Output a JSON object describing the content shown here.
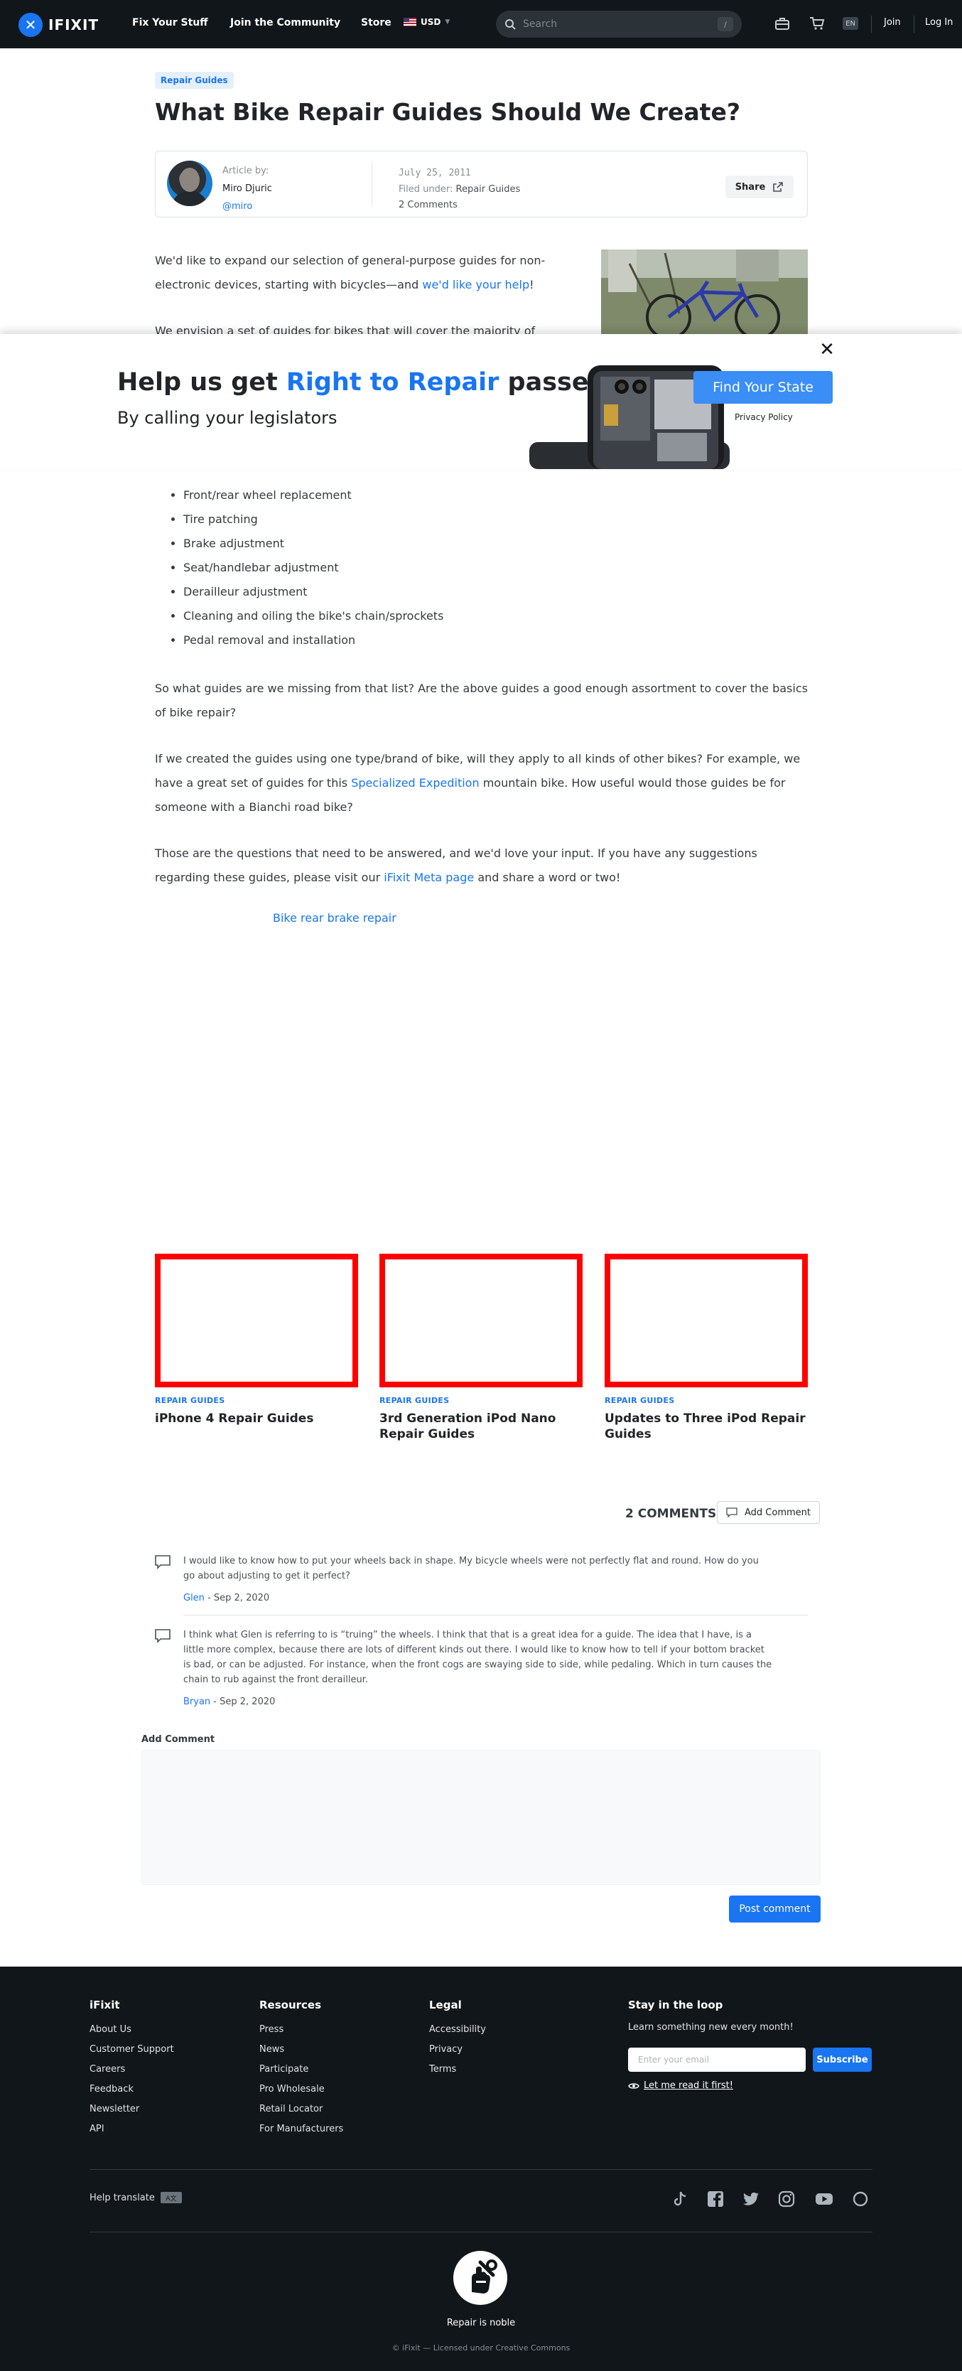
{
  "nav": {
    "logo_text": "IFIXIT",
    "links": [
      "Fix Your Stuff",
      "Join the Community",
      "Store"
    ],
    "currency": "USD",
    "search_placeholder": "Search",
    "search_shortcut": "/",
    "language": "EN",
    "join": "Join",
    "login": "Log In"
  },
  "article": {
    "tag": "Repair Guides",
    "title": "What Bike Repair Guides Should We Create?",
    "byline_label": "Article by:",
    "author": "Miro Djuric",
    "handle": "@miro",
    "date": "July 25, 2011",
    "filed_label": "Filed under:",
    "filed_value": "Repair Guides",
    "comments": "2 Comments",
    "share": "Share",
    "p1_text": "We'd like to expand our selection of general-purpose guides for non-electronic devices, starting with bicycles—and ",
    "p1_link": "we'd like your help",
    "p1_end": "!",
    "p2_partial": "We envision a set of guides for bikes that will cover the majority of",
    "list": [
      "Front/rear wheel replacement",
      "Tire patching",
      "Brake adjustment",
      "Seat/handlebar adjustment",
      "Derailleur adjustment",
      "Cleaning and oiling the bike's chain/sprockets",
      "Pedal removal and installation"
    ],
    "p3": "So what guides are we missing from that list? Are the above guides a good enough assortment to cover the basics of bike repair?",
    "p4_text": "If we created the guides using one type/brand of bike, will they apply to all kinds of other bikes? For example, we have a great set of guides for this ",
    "p4_link": "Specialized Expedition",
    "p4_end": " mountain bike. How useful would those guides be for someone with a Bianchi road bike?",
    "p5_text": "Those are the questions that need to be answered, and we'd love your input. If you have any suggestions regarding these guides, please visit our ",
    "p5_link": "iFixit Meta page",
    "p5_end": " and share a word or two!",
    "image_link": "Bike rear brake repair"
  },
  "banner": {
    "title_pre": "Help us get ",
    "title_highlight": "Right to Repair",
    "title_post": " passed",
    "subtitle": "By calling your legislators",
    "cta": "Find Your State",
    "privacy": "Privacy Policy"
  },
  "related": [
    {
      "kicker": "REPAIR GUIDES",
      "title": "iPhone 4 Repair Guides"
    },
    {
      "kicker": "REPAIR GUIDES",
      "title": "3rd Generation iPod Nano Repair Guides"
    },
    {
      "kicker": "REPAIR GUIDES",
      "title": "Updates to Three iPod Repair Guides"
    }
  ],
  "comments": {
    "count": "2 COMMENTS",
    "add_button": "Add Comment",
    "items": [
      {
        "text": "I would like to know how to put your wheels back in shape. My bicycle wheels were not perfectly flat and round. How do you go about adjusting to get it perfect?",
        "author": "Glen",
        "date": " - Sep 2, 2020"
      },
      {
        "text": "I think what Glen is referring to is “truing” the wheels. I think that that is a great idea for a guide. The idea that I have, is a little more complex, because there are lots of different kinds out there. I would like to know how to tell if your bottom bracket is bad, or can be adjusted. For instance, when the front cogs are swaying side to side, while pedaling. Which in turn causes the chain to rub against the front derailleur.",
        "author": "Bryan",
        "date": " - Sep 2, 2020"
      }
    ],
    "form_label": "Add Comment",
    "post_button": "Post comment"
  },
  "footer": {
    "columns": [
      {
        "title": "iFixit",
        "items": [
          "About Us",
          "Customer Support",
          "Careers",
          "Feedback",
          "Newsletter",
          "API"
        ]
      },
      {
        "title": "Resources",
        "items": [
          "Press",
          "News",
          "Participate",
          "Pro Wholesale",
          "Retail Locator",
          "For Manufacturers"
        ]
      },
      {
        "title": "Legal",
        "items": [
          "Accessibility",
          "Privacy",
          "Terms"
        ]
      }
    ],
    "stay_title": "Stay in the loop",
    "stay_sub": "Learn something new every month!",
    "email_placeholder": "Enter your email",
    "subscribe": "Subscribe",
    "read_first": "Let me read it first!",
    "help_translate": "Help translate",
    "tagline": "Repair is noble",
    "copyright": "© iFixit — Licensed under Creative Commons"
  },
  "colors": {
    "brand_blue": "#1975f1",
    "nav_bg": "#11161a",
    "placeholder_red": "#ff0000"
  },
  "icons": [
    "search-icon",
    "toolbox-icon",
    "cart-icon",
    "share-external-icon",
    "close-icon",
    "comment-icon",
    "eye-icon",
    "tiktok-icon",
    "facebook-icon",
    "twitter-icon",
    "instagram-icon",
    "youtube-icon",
    "repair-hand-logo-icon"
  ]
}
